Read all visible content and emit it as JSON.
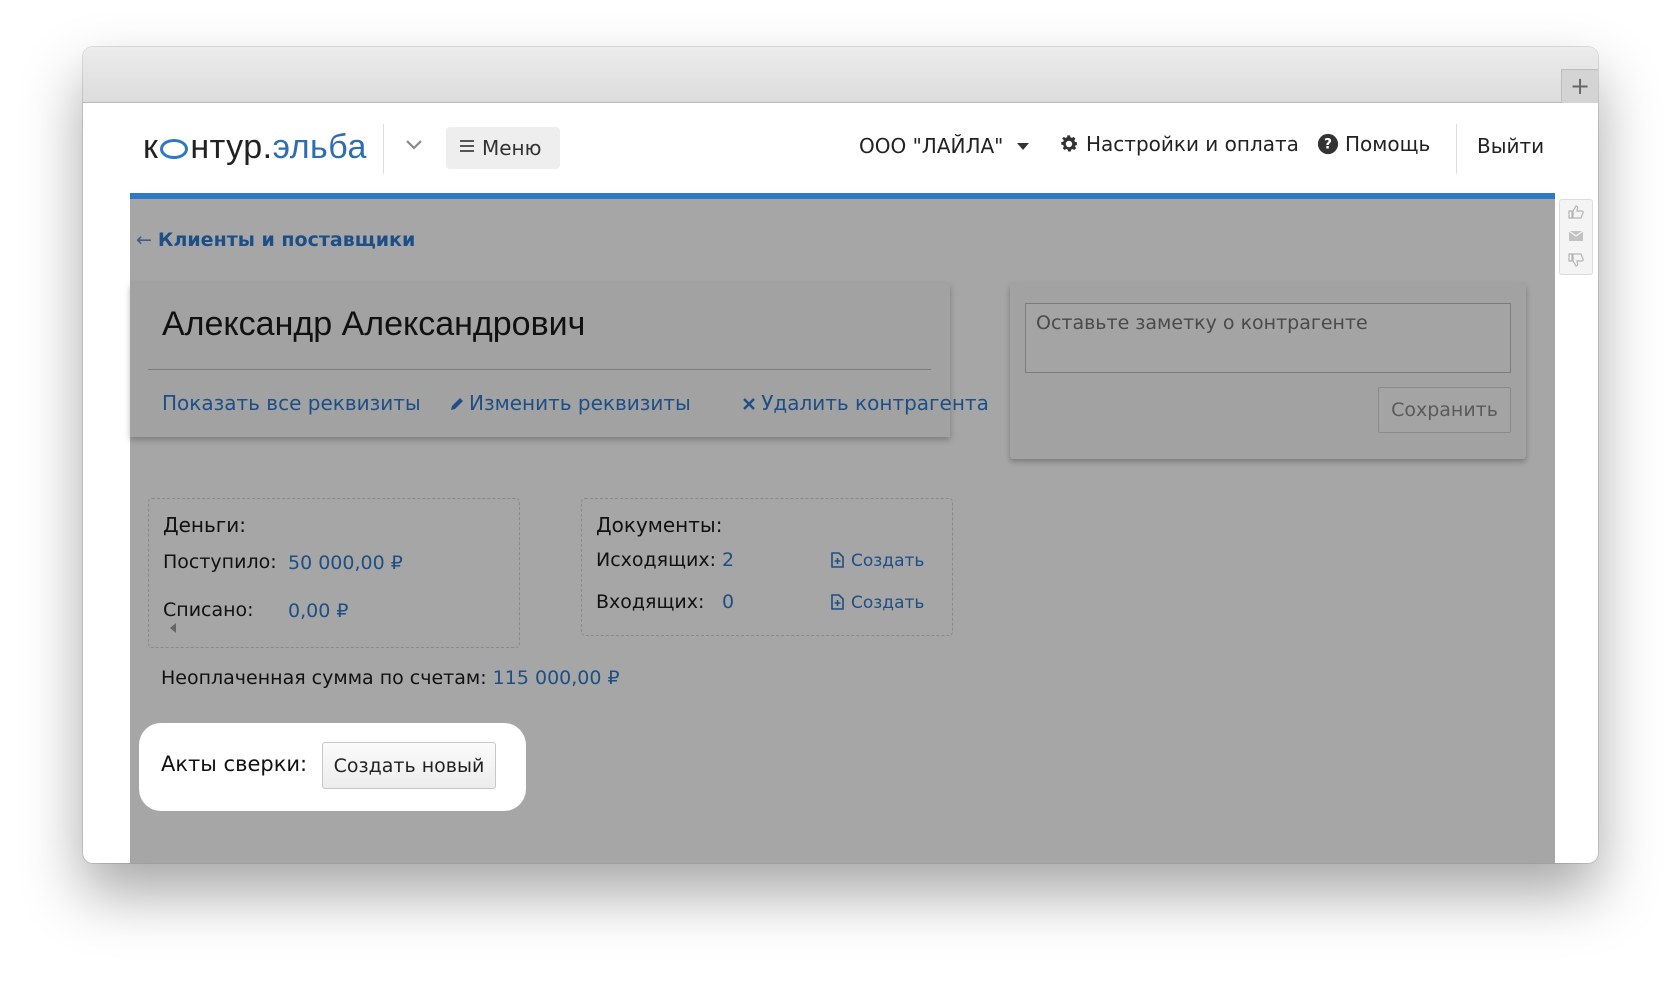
{
  "window": {
    "newtab_symbol": "+"
  },
  "header": {
    "logo": {
      "part1": "к",
      "part2": "нтур",
      "dot": ".",
      "part3": "эльба"
    },
    "menu_label": "Меню",
    "org_name": "ООО \"ЛАЙЛА\"",
    "settings_label": "Настройки и оплата",
    "help_label": "Помощь",
    "logout_label": "Выйти",
    "accent": "#2d79c6"
  },
  "breadcrumb": {
    "arrow": "←",
    "label": "Клиенты и поставщики"
  },
  "contractor": {
    "name": "Александр Александрович",
    "show_all_details": "Показать все реквизиты",
    "edit_details": "Изменить реквизиты",
    "delete_contractor": "Удалить контрагента"
  },
  "note": {
    "placeholder": "Оставьте заметку о контрагенте",
    "save_label": "Сохранить"
  },
  "money": {
    "title": "Деньги:",
    "received_label": "Поступило:",
    "received_value": "50 000,00 ₽",
    "written_off_label": "Списано:",
    "written_off_value": "0,00 ₽"
  },
  "documents": {
    "title": "Документы:",
    "outgoing_label": "Исходящих:",
    "outgoing_value": "2",
    "incoming_label": "Входящих:",
    "incoming_value": "0",
    "create_label": "Создать"
  },
  "unpaid": {
    "label": "Неоплаченная сумма по счетам:",
    "value": "115 000,00 ₽"
  },
  "acts": {
    "label": "Акты сверки:",
    "create_new": "Создать новый"
  }
}
